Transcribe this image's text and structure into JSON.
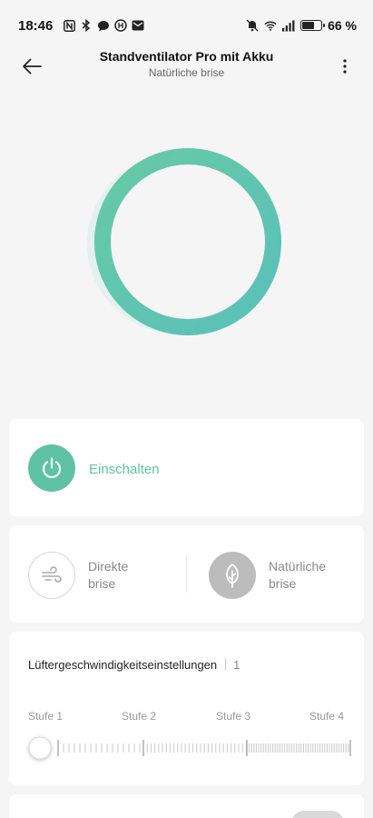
{
  "status": {
    "time": "18:46",
    "battery_percent": "66 %",
    "battery_level": 0.66,
    "left_icons": [
      "nfc-icon",
      "bluetooth-icon",
      "chat-icon",
      "app-notification-icon",
      "email-icon"
    ],
    "right_icons": [
      "mute-icon",
      "wifi-icon",
      "signal-icon",
      "battery-icon"
    ]
  },
  "header": {
    "title": "Standventilator Pro mit Akku",
    "subtitle": "Natürliche brise",
    "back_icon": "arrow-left-icon",
    "more_icon": "more-vertical-icon"
  },
  "colors": {
    "accent": "#5fc3a3",
    "ring_start": "#64c9a4",
    "ring_end": "#5bbfb8",
    "inactive_gray": "#bcbcbc"
  },
  "power": {
    "label": "Einschalten",
    "icon": "power-icon"
  },
  "modes": {
    "direct": {
      "label_line1": "Direkte",
      "label_line2": "brise",
      "icon": "wind-icon",
      "active": false
    },
    "natural": {
      "label_line1": "Natürliche",
      "label_line2": "brise",
      "icon": "leaf-icon",
      "active": true
    }
  },
  "speed": {
    "title": "Lüftergeschwindigkeitseinstellungen",
    "value": "1",
    "levels": [
      "Stufe 1",
      "Stufe 2",
      "Stufe 3",
      "Stufe 4"
    ]
  }
}
